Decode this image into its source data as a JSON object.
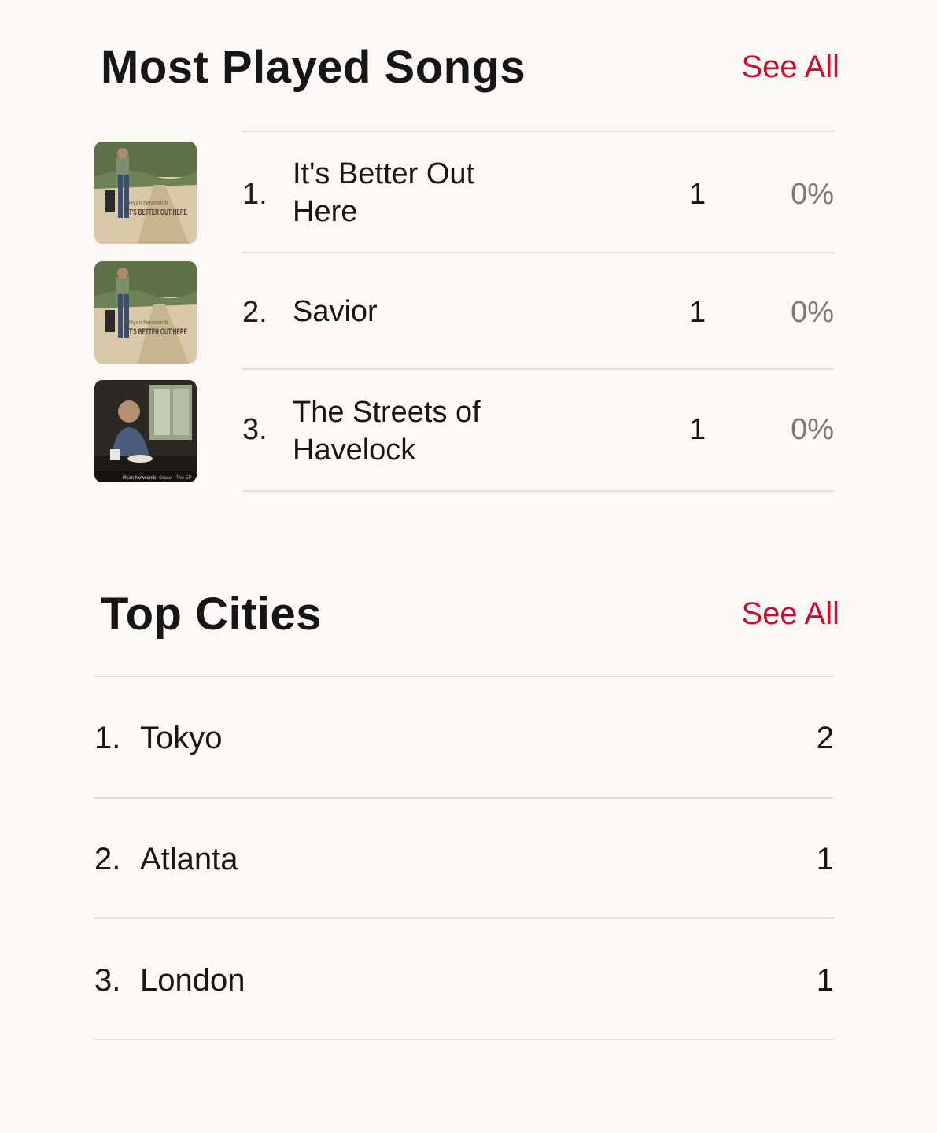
{
  "most_played": {
    "title": "Most Played Songs",
    "see_all": "See All",
    "songs": [
      {
        "rank": "1.",
        "title": "It's Better Out Here",
        "plays": "1",
        "percent": "0%",
        "art": {
          "artist": "Ryan Newcomb",
          "album": "IT'S BETTER OUT HERE"
        }
      },
      {
        "rank": "2.",
        "title": "Savior",
        "plays": "1",
        "percent": "0%",
        "art": {
          "artist": "Ryan Newcomb",
          "album": "IT'S BETTER OUT HERE"
        }
      },
      {
        "rank": "3.",
        "title": "The Streets of Havelock",
        "plays": "1",
        "percent": "0%",
        "art": {
          "artist": "Ryan Newcomb",
          "album": "Grace - The EP"
        }
      }
    ]
  },
  "top_cities": {
    "title": "Top Cities",
    "see_all": "See All",
    "cities": [
      {
        "rank": "1.",
        "name": "Tokyo",
        "count": "2"
      },
      {
        "rank": "2.",
        "name": "Atlanta",
        "count": "1"
      },
      {
        "rank": "3.",
        "name": "London",
        "count": "1"
      }
    ]
  },
  "colors": {
    "accent": "#c8102e",
    "background": "#fcf8f6",
    "divider": "#e3dfdc"
  }
}
